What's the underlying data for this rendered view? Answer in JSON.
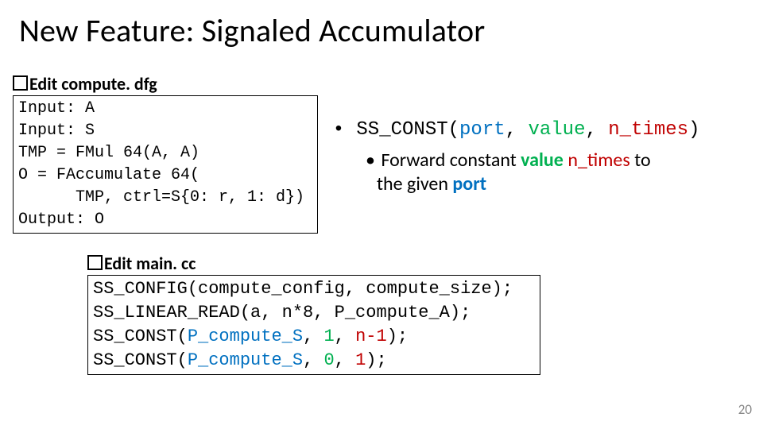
{
  "title": "New Feature: Signaled Accumulator",
  "edit1": {
    "label_prefix": "Edit ",
    "filename": "compute. dfg"
  },
  "code1": {
    "l1": "Input: A",
    "l2": "Input: S",
    "l3": "TMP = FMul 64(A, A)",
    "l4": "O = FAccumulate 64(",
    "l5": "      TMP, ctrl=S{0: r, 1: d})",
    "l6": "Output: O"
  },
  "api": {
    "fn": "SS_CONST",
    "arg_port": "port",
    "arg_value": "value",
    "arg_ntimes": "n_times",
    "sub_pre": "Forward constant ",
    "sub_value": "value",
    "sub_mid": " ",
    "sub_ntimes": "n_times",
    "sub_post1": " to",
    "sub_post2": "the given ",
    "sub_port": "port"
  },
  "edit2": {
    "label_prefix": "Edit ",
    "filename": "main. cc"
  },
  "code2": {
    "l1": "SS_CONFIG(compute_config, compute_size);",
    "l2": "SS_LINEAR_READ(a, n*8, P_compute_A);",
    "l3_pre": "SS_CONST(",
    "l3_port": "P_compute_S",
    "l3_c1": ", ",
    "l3_val": "1",
    "l3_c2": ", ",
    "l3_n": "n-1",
    "l3_post": ");",
    "l4_pre": "SS_CONST(",
    "l4_port": "P_compute_S",
    "l4_c1": ", ",
    "l4_val": "0",
    "l4_c2": ", ",
    "l4_n": "1",
    "l4_post": ");"
  },
  "page_number": "20"
}
